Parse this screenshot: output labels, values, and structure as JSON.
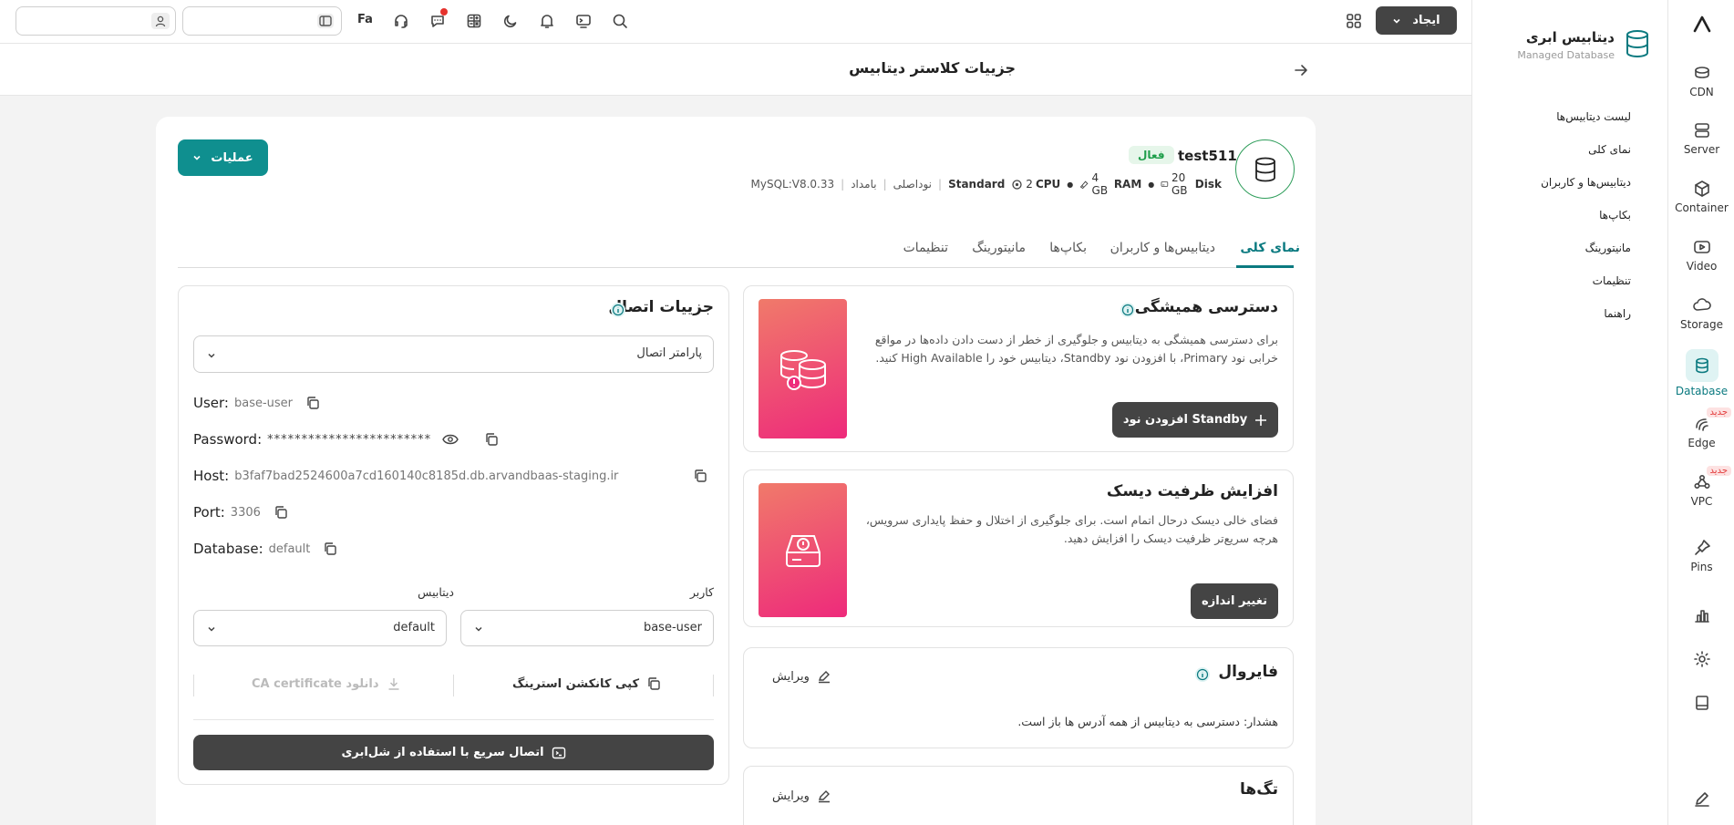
{
  "rail": {
    "items": [
      {
        "label": "CDN",
        "icon": "cdn-icon"
      },
      {
        "label": "Server",
        "icon": "server-icon"
      },
      {
        "label": "Container",
        "icon": "container-icon"
      },
      {
        "label": "Video",
        "icon": "video-icon"
      },
      {
        "label": "Storage",
        "icon": "storage-icon"
      },
      {
        "label": "Database",
        "icon": "database-icon"
      },
      {
        "label": "Edge",
        "icon": "edge-icon",
        "badge": "جدید"
      },
      {
        "label": "VPC",
        "icon": "vpc-icon",
        "badge": "جدید"
      },
      {
        "label": "Pins",
        "icon": "pin-icon"
      }
    ]
  },
  "sidebar": {
    "title": "دیتابیس ابری",
    "subtitle": "Managed Database",
    "links": [
      "لیست دیتابیس‌ها",
      "نمای کلی",
      "دیتابیس‌ها و کاربران",
      "بکاپ‌ها",
      "مانیتورینگ",
      "تنظیمات",
      "راهنما"
    ]
  },
  "topbar": {
    "create_label": "ایجاد",
    "lang_label": "Fa"
  },
  "page": {
    "title": "جزییات کلاستر دیتابیس"
  },
  "cluster": {
    "name": "test511",
    "status": "فعال",
    "disk": "20 GB",
    "disk_unit": "Disk",
    "ram": "4 GB",
    "ram_unit": "RAM",
    "cpu": "2",
    "cpu_unit": "CPU",
    "plan": "Standard",
    "node": "نوداصلی",
    "region": "بامداد",
    "version": "MySQL:V8.0.33",
    "actions_label": "عملیات"
  },
  "tabs": [
    "نمای کلی",
    "دیتابیس‌ها و کاربران",
    "بکاپ‌ها",
    "مانیتورینگ",
    "تنظیمات"
  ],
  "ha": {
    "title": "دسترسی همیشگی",
    "desc": "برای دسترسی همیشگی به دیتابیس و جلوگیری از خطر از دست دادن داده‌ها در مواقع خرابی نود Primary، با افزودن نود Standby، دیتابیس خود را High Available کنید.",
    "button": "افزودن نود Standby"
  },
  "disk": {
    "title": "افزایش ظرفیت دیسک",
    "desc": "فضای خالی دیسک درحال اتمام است. برای جلوگیری از اختلال و حفظ پایداری سرویس، هرچه سریع‌تر ظرفیت دیسک را افزایش دهید.",
    "button": "تغییر اندازه"
  },
  "firewall": {
    "title": "فایروال",
    "edit": "ویرایش",
    "warning": "هشدار: دسترسی به دیتابیس از همه آدرس ها باز است."
  },
  "tags": {
    "title": "تگ‌ها",
    "edit": "ویرایش"
  },
  "connection": {
    "title": "جزییات اتصال",
    "select_value": "پارامتر اتصال",
    "user_label": "User:",
    "user_value": "base-user",
    "password_label": "Password:",
    "password_value": "************************",
    "host_label": "Host:",
    "host_value": "b3faf7bad2524600a7cd160140c8185d.db.arvandbaas-staging.ir",
    "port_label": "Port:",
    "port_value": "3306",
    "database_label": "Database:",
    "database_value": "default",
    "user_select_label": "کاربر",
    "user_select_value": "base-user",
    "db_select_label": "دیتابیس",
    "db_select_value": "default",
    "copy_conn": "کپی کانکشن استرینگ",
    "download_ca": "دانلود CA certificate",
    "shell_button": "اتصال سریع با استفاده از شل‌ابری"
  }
}
